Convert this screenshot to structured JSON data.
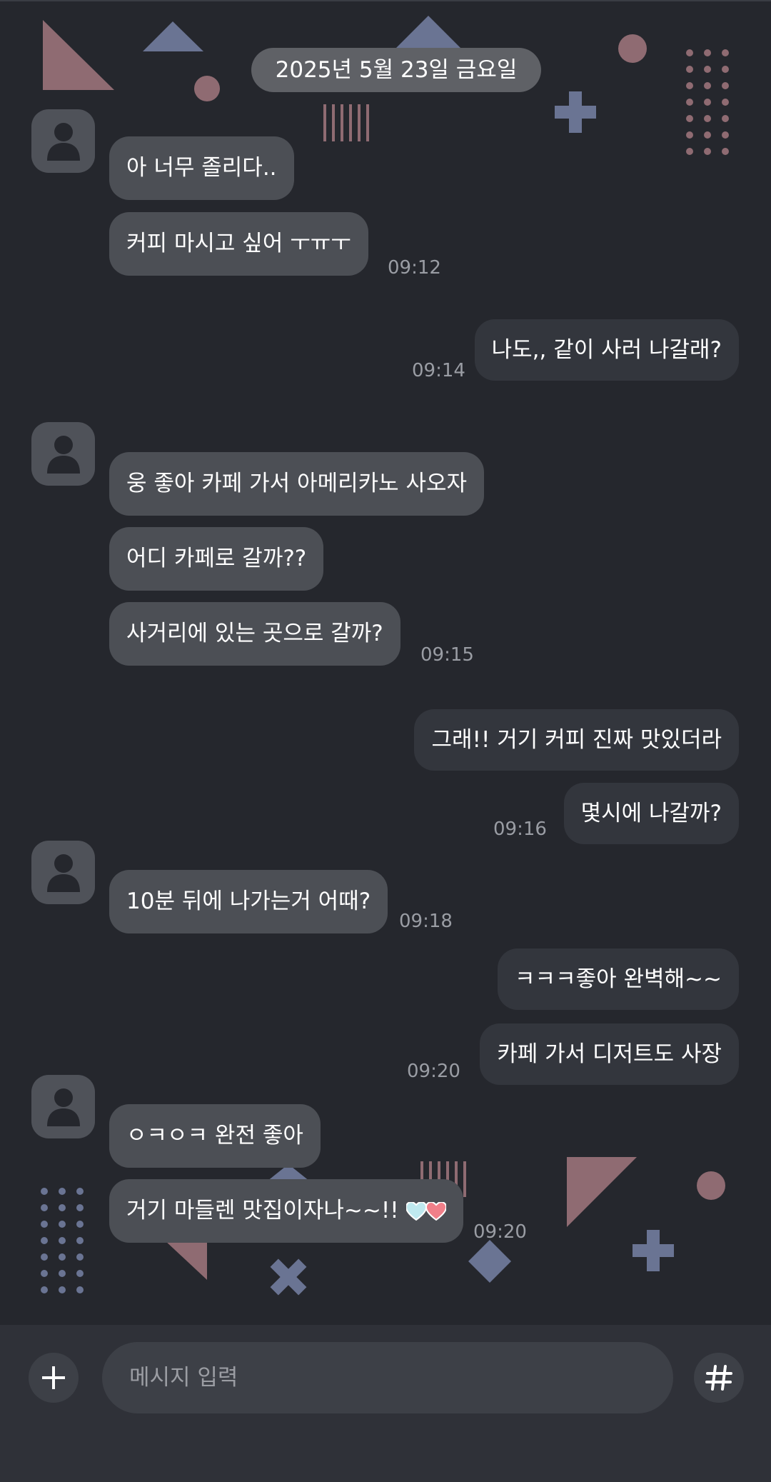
{
  "colors": {
    "background": "#25272d",
    "incoming_bubble": "#4c4f55",
    "outgoing_bubble": "#33363d",
    "accent_pink": "#8f6b72",
    "accent_blue": "#6a7493"
  },
  "date_divider": "2025년 5월 23일 금요일",
  "messages": {
    "m1": "아 너무 졸리다..",
    "m2": "커피 마시고 싶어 ㅜㅠㅜ",
    "t1": "09:12",
    "m3": "나도,, 같이 사러 나갈래?",
    "t2": "09:14",
    "m4": "웅 좋아 카페 가서 아메리카노 사오자",
    "m5": "어디 카페로 갈까??",
    "m6": "사거리에 있는 곳으로 갈까?",
    "t3": "09:15",
    "m7": "그래!! 거기 커피 진짜 맛있더라",
    "m8": "몇시에 나갈까?",
    "t4": "09:16",
    "m9": "10분 뒤에 나가는거 어때?",
    "t5": "09:18",
    "m10": "ㅋㅋㅋ좋아 완벽해~~",
    "m11": "카페 가서 디저트도 사장",
    "t6": "09:20",
    "m12": "ㅇㅋㅇㅋ 완전 좋아",
    "m13": "거기 마들렌 맛집이자나~~!!",
    "t7": "09:20"
  },
  "composer": {
    "placeholder": "메시지 입력",
    "plus_icon": "plus-icon",
    "hash_icon": "hash-icon"
  }
}
